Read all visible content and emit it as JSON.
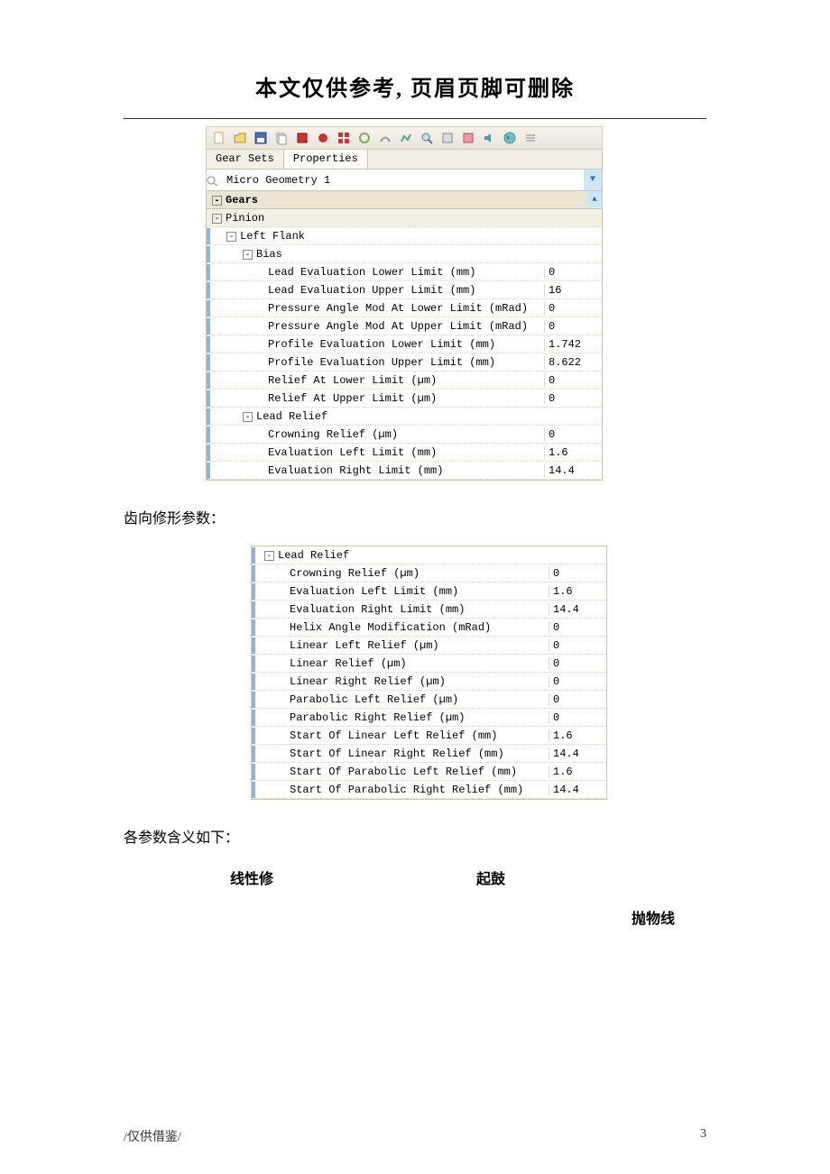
{
  "header_title": "本文仅供参考, 页眉页脚可删除",
  "tabs": {
    "gear_sets": "Gear Sets",
    "properties": "Properties"
  },
  "dropdown": {
    "label": "Micro Geometry 1"
  },
  "tree1": {
    "gears_header": "Gears",
    "pinion": "Pinion",
    "left_flank": "Left Flank",
    "bias": "Bias",
    "bias_rows": [
      {
        "label": "Lead Evaluation Lower Limit (mm)",
        "value": "0"
      },
      {
        "label": "Lead Evaluation Upper Limit (mm)",
        "value": "16"
      },
      {
        "label": "Pressure Angle Mod At Lower Limit (mRad)",
        "value": "0"
      },
      {
        "label": "Pressure Angle Mod At Upper Limit (mRad)",
        "value": "0"
      },
      {
        "label": "Profile Evaluation Lower Limit (mm)",
        "value": "1.742"
      },
      {
        "label": "Profile Evaluation Upper Limit (mm)",
        "value": "8.622"
      },
      {
        "label": "Relief At Lower Limit (µm)",
        "value": "0"
      },
      {
        "label": "Relief At Upper Limit (µm)",
        "value": "0"
      }
    ],
    "lead_relief": "Lead Relief",
    "lead_relief_rows": [
      {
        "label": "Crowning Relief (µm)",
        "value": "0"
      },
      {
        "label": "Evaluation Left Limit (mm)",
        "value": "1.6"
      },
      {
        "label": "Evaluation Right Limit (mm)",
        "value": "14.4"
      }
    ]
  },
  "body_text_1": "齿向修形参数：",
  "tree2": {
    "lead_relief": "Lead Relief",
    "rows": [
      {
        "label": "Crowning Relief (µm)",
        "value": "0"
      },
      {
        "label": "Evaluation Left Limit (mm)",
        "value": "1.6"
      },
      {
        "label": "Evaluation Right Limit (mm)",
        "value": "14.4"
      },
      {
        "label": "Helix Angle Modification (mRad)",
        "value": "0"
      },
      {
        "label": "Linear Left Relief (µm)",
        "value": "0"
      },
      {
        "label": "Linear Relief (µm)",
        "value": "0"
      },
      {
        "label": "Linear Right Relief (µm)",
        "value": "0"
      },
      {
        "label": "Parabolic Left Relief (µm)",
        "value": "0"
      },
      {
        "label": "Parabolic Right Relief (µm)",
        "value": "0"
      },
      {
        "label": "Start Of Linear Left Relief (mm)",
        "value": "1.6"
      },
      {
        "label": "Start Of Linear Right Relief (mm)",
        "value": "14.4"
      },
      {
        "label": "Start Of Parabolic Left Relief (mm)",
        "value": "1.6"
      },
      {
        "label": "Start Of Parabolic Right Relief (mm)",
        "value": "14.4"
      }
    ]
  },
  "body_text_2": "各参数含义如下：",
  "legend": {
    "l1": "线性修",
    "l2": "起鼓",
    "l3": "抛物线"
  },
  "footer": {
    "left": "/仅供借鉴/",
    "right": "3"
  }
}
